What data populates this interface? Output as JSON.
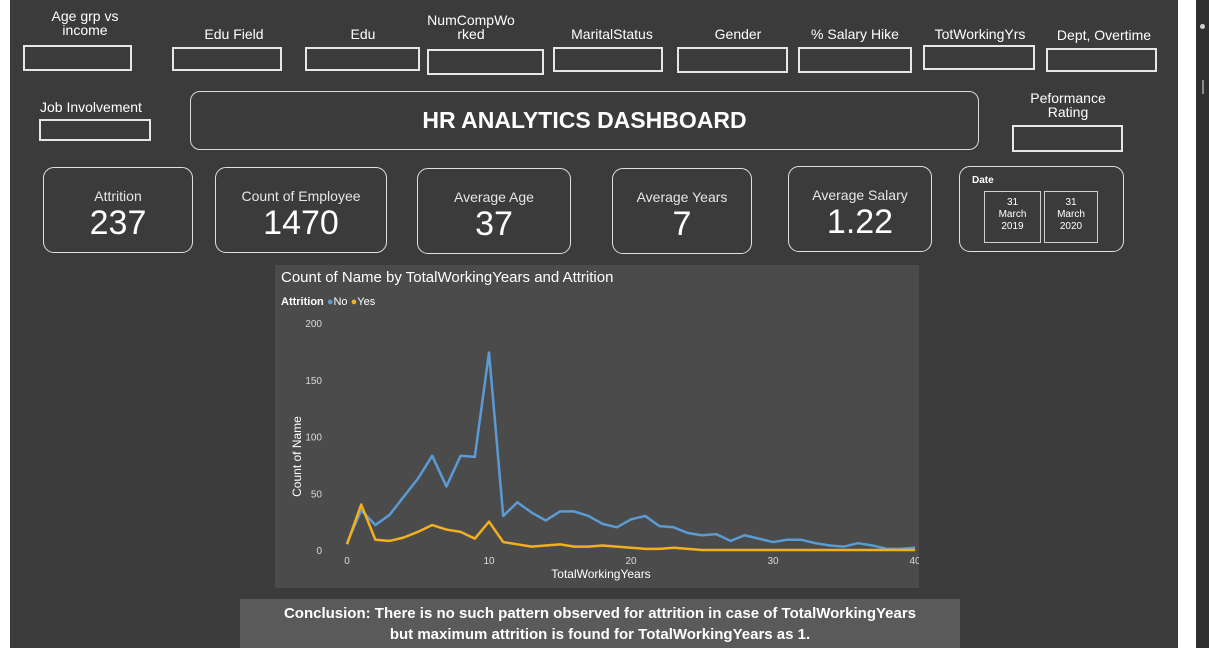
{
  "slicers": [
    {
      "label": "Age grp vs income"
    },
    {
      "label": "Edu Field"
    },
    {
      "label": "Edu"
    },
    {
      "label": "NumCompWorked"
    },
    {
      "label": "MaritalStatus"
    },
    {
      "label": "Gender"
    },
    {
      "label": "% Salary Hike"
    },
    {
      "label": "TotWorkingYrs"
    },
    {
      "label": "Dept, Overtime"
    }
  ],
  "job_involvement": {
    "label": "Job Involvement"
  },
  "performance_rating": {
    "label": "Peformance Rating"
  },
  "title": "HR ANALYTICS DASHBOARD",
  "cards": [
    {
      "label": "Attrition",
      "value": "237"
    },
    {
      "label": "Count of Employee",
      "value": "1470"
    },
    {
      "label": "Average Age",
      "value": "37"
    },
    {
      "label": "Average Years",
      "value": "7"
    },
    {
      "label": "Average Salary",
      "value": "1.22"
    }
  ],
  "date_card": {
    "label": "Date",
    "start": {
      "day": "31",
      "month": "March",
      "year": "2019"
    },
    "end": {
      "day": "31",
      "month": "March",
      "year": "2020"
    }
  },
  "chart_data": {
    "type": "line",
    "title": "Count of Name by TotalWorkingYears and Attrition",
    "legend_title": "Attrition",
    "legend_position": "top-left",
    "xlabel": "TotalWorkingYears",
    "ylabel": "Count of Name",
    "xlim": [
      0,
      40
    ],
    "ylim": [
      0,
      200
    ],
    "x_ticks": [
      "0",
      "10",
      "20",
      "30",
      "40"
    ],
    "y_ticks": [
      "0",
      "50",
      "100",
      "150",
      "200"
    ],
    "grid": false,
    "x": [
      0,
      1,
      2,
      3,
      4,
      5,
      6,
      7,
      8,
      9,
      10,
      11,
      12,
      13,
      14,
      15,
      16,
      17,
      18,
      19,
      20,
      21,
      22,
      23,
      24,
      25,
      26,
      27,
      28,
      29,
      30,
      31,
      32,
      33,
      34,
      35,
      36,
      37,
      38,
      39,
      40
    ],
    "series": [
      {
        "name": "No",
        "color": "#5b9bd5",
        "values": [
          6,
          35,
          22,
          31,
          47,
          63,
          83,
          56,
          83,
          82,
          174,
          30,
          42,
          33,
          26,
          34,
          34,
          30,
          23,
          20,
          27,
          30,
          21,
          20,
          15,
          13,
          14,
          8,
          13,
          10,
          7,
          9,
          9,
          6,
          4,
          3,
          6,
          4,
          1,
          1,
          2
        ]
      },
      {
        "name": "Yes",
        "color": "#f2b01e",
        "values": [
          5,
          40,
          9,
          8,
          11,
          16,
          22,
          18,
          16,
          10,
          25,
          7,
          5,
          3,
          4,
          5,
          3,
          3,
          4,
          3,
          2,
          1,
          1,
          2,
          1,
          0,
          0,
          0,
          0,
          0,
          0,
          0,
          0,
          0,
          0,
          0,
          0,
          0,
          0,
          0,
          0
        ]
      }
    ]
  },
  "conclusion": {
    "line1": "Conclusion: There is no such pattern observed for attrition in case of TotalWorkingYears",
    "line2": "but maximum attrition is found for TotalWorkingYears as 1."
  }
}
